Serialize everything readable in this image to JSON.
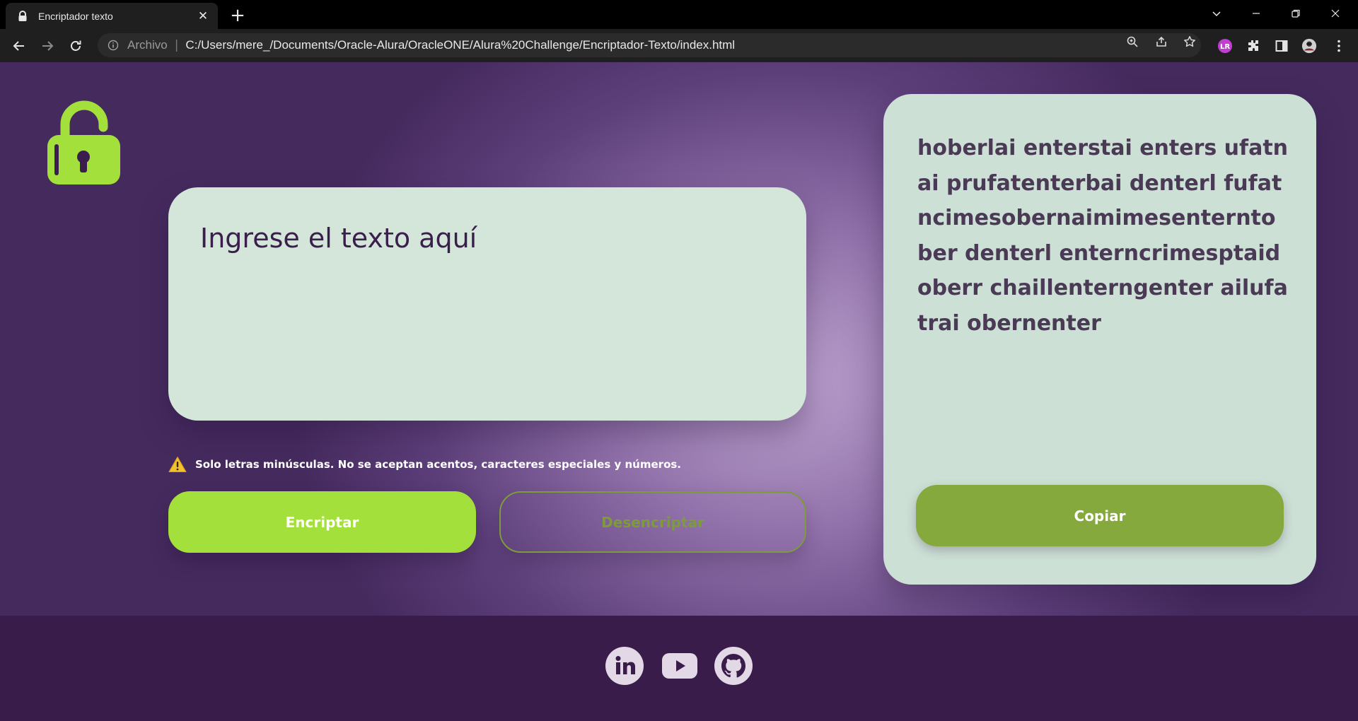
{
  "browser": {
    "tab_title": "Encriptador texto",
    "tab_close_glyph": "✕",
    "new_tab_glyph": "+",
    "scheme_label": "Archivo",
    "scheme_separator": "|",
    "url": "C:/Users/mere_/Documents/Oracle-Alura/OracleONE/Alura%20Challenge/Encriptador-Texto/index.html"
  },
  "main": {
    "input_placeholder": "Ingrese el texto aquí",
    "warning_text": "Solo letras minúsculas. No se aceptan acentos, caracteres especiales y números.",
    "encrypt_label": "Encriptar",
    "decrypt_label": "Desencriptar",
    "output_text": "hoberlai enterstai enters ufatnai prufatenterbai denterl fufatncimesobernaimimesenternto ber denterl enterncrimesptaidoberr chaillenterngenter ailufatrai obernenter",
    "copy_label": "Copiar"
  },
  "footer": {
    "links": [
      "linkedin-icon",
      "youtube-icon",
      "github-icon"
    ]
  },
  "colors": {
    "accent_green": "#a3e03c",
    "copy_green": "#86a93d",
    "card_bg": "#d3e6d9",
    "text_purple": "#3b1e4d",
    "footer_bg": "#3a1c4a"
  }
}
